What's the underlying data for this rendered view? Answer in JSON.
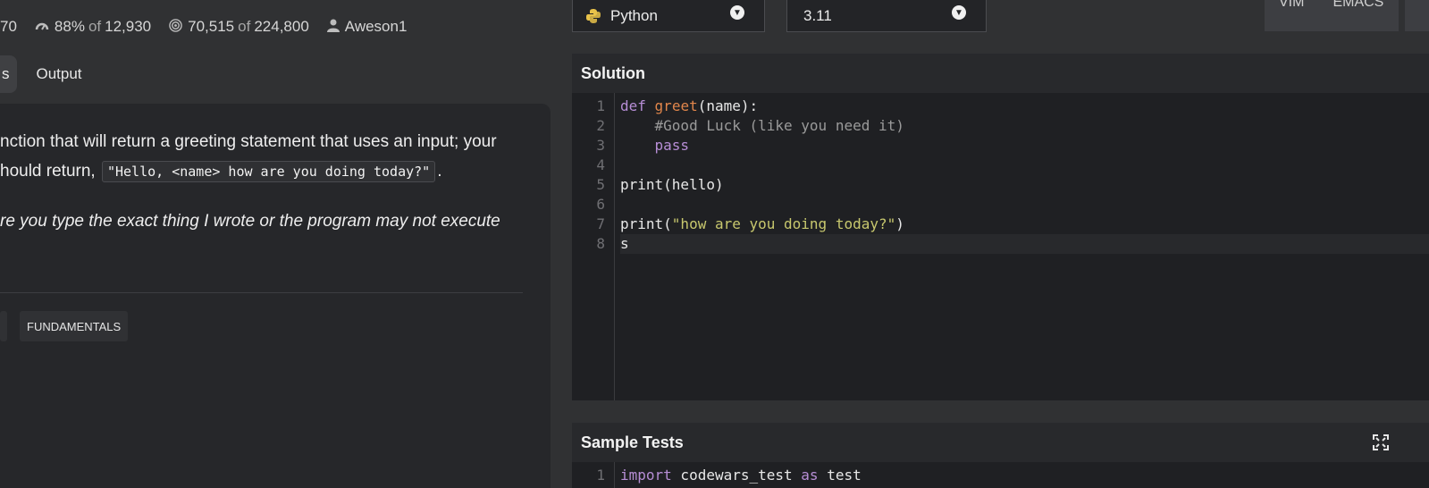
{
  "stats": {
    "rank_partial": "70",
    "satisfaction_pct": "88%",
    "satisfaction_of": "of",
    "satisfaction_total": "12,930",
    "completed": "70,515",
    "completed_of": "of",
    "completed_total": "224,800",
    "author": "Aweson1"
  },
  "tabs": {
    "partial_tab": "s",
    "output_tab": "Output"
  },
  "description": {
    "line1": "nction that will return a greeting statement that uses an input; your",
    "line2_prefix": "hould return,",
    "line2_code": "\"Hello, <name> how are you doing today?\"",
    "line2_suffix": ".",
    "line3_italic": "re you type the exact thing I wrote or the program may not execute"
  },
  "tags": [
    "FUNDAMENTALS"
  ],
  "language_select": {
    "value": "Python"
  },
  "version_select": {
    "value": "3.11"
  },
  "mode_buttons": {
    "vim": "VIM",
    "emacs": "EMACS"
  },
  "solution": {
    "title": "Solution",
    "line_numbers": [
      "1",
      "2",
      "3",
      "4",
      "5",
      "6",
      "7",
      "8"
    ]
  },
  "sample_tests": {
    "title": "Sample Tests",
    "line_numbers": [
      "1"
    ]
  },
  "colors": {
    "keyword": "#b78ed6",
    "function": "#e1864b",
    "comment": "#9a9a9a",
    "string": "#c8c86e"
  }
}
